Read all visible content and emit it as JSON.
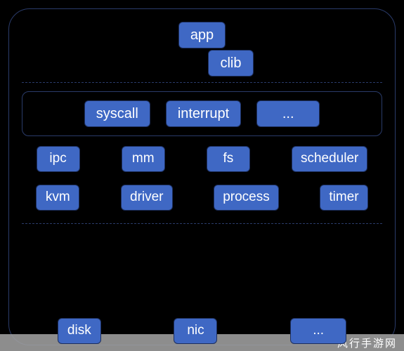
{
  "top": {
    "app": "app",
    "clib": "clib"
  },
  "kernel_entry": {
    "syscall": "syscall",
    "interrupt": "interrupt",
    "more": "..."
  },
  "subsystems_row1": {
    "ipc": "ipc",
    "mm": "mm",
    "fs": "fs",
    "scheduler": "scheduler"
  },
  "subsystems_row2": {
    "kvm": "kvm",
    "driver": "driver",
    "process": "process",
    "timer": "timer"
  },
  "hardware": {
    "disk": "disk",
    "nic": "nic",
    "more": "..."
  },
  "watermark": "风行手游网",
  "colors": {
    "node_bg": "#3f68c4",
    "node_border": "#1d2f5e",
    "panel_border": "#2a3b6a",
    "bg": "#000000"
  }
}
